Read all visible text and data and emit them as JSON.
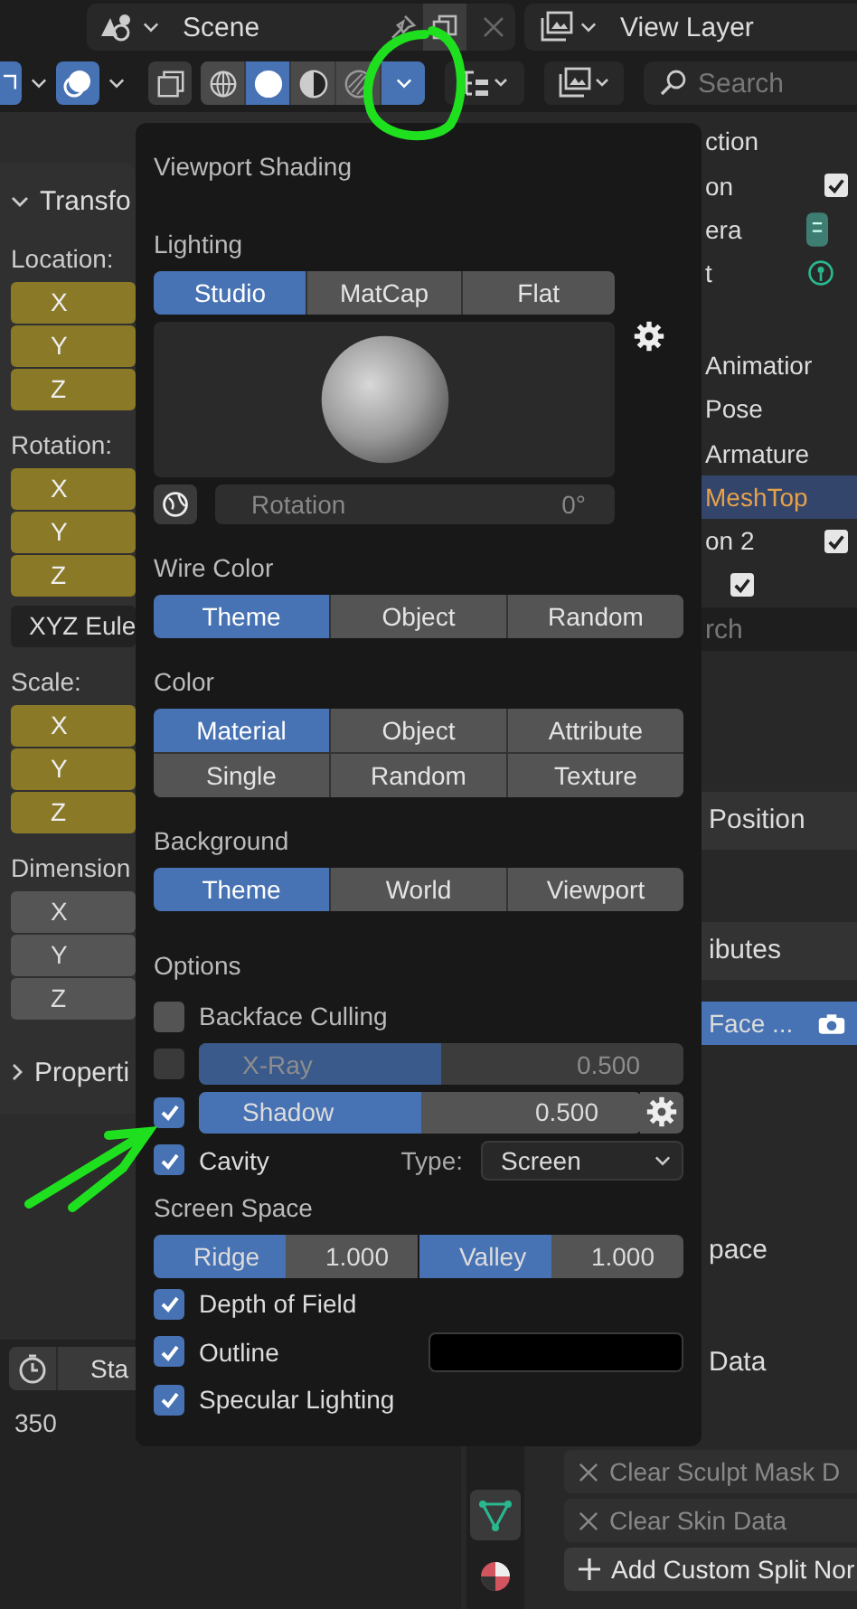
{
  "header": {
    "scene": "Scene",
    "view_layer": "View Layer"
  },
  "toolbar": {
    "shading_modes": [
      {
        "kind": "wireframe",
        "selected": false
      },
      {
        "kind": "solid",
        "selected": true
      },
      {
        "kind": "material",
        "selected": false
      },
      {
        "kind": "rendered",
        "selected": false
      }
    ],
    "shading_menu_expanded": true,
    "search": {
      "placeholder": "Search"
    }
  },
  "transform_panel": {
    "title": "Transfo",
    "groups": [
      {
        "label": "Location:",
        "fields": [
          "X",
          "Y",
          "Z"
        ],
        "keyframed": true
      },
      {
        "label": "Rotation:",
        "fields": [
          "X",
          "Y",
          "Z"
        ],
        "keyframed": true,
        "mode": "XYZ Eule"
      },
      {
        "label": "Scale:",
        "fields": [
          "X",
          "Y",
          "Z"
        ],
        "keyframed": true
      },
      {
        "label": "Dimension",
        "fields": [
          "X",
          "Y",
          "Z"
        ],
        "keyframed": false
      }
    ],
    "next_panel": "Properti"
  },
  "timeline": {
    "start_label": "Sta",
    "frame": "350"
  },
  "outliner": {
    "rows": [
      {
        "label": "ction",
        "kind": "plain",
        "selected": false
      },
      {
        "label": "on",
        "kind": "checkbox",
        "checked": true,
        "selected": false
      },
      {
        "label": "era",
        "kind": "camera",
        "selected": false
      },
      {
        "label": "t",
        "kind": "light",
        "selected": false
      },
      {
        "label": "Animatior",
        "kind": "plain",
        "selected": false
      },
      {
        "label": "Pose",
        "kind": "plain",
        "selected": false
      },
      {
        "label": "Armature",
        "kind": "plain",
        "selected": false
      },
      {
        "label": "MeshTop",
        "kind": "plain",
        "selected": true
      },
      {
        "label": "on 2",
        "kind": "checkbox",
        "checked": true,
        "selected": false
      },
      {
        "kind": "checkbox",
        "checked": true,
        "selected": false
      }
    ],
    "search": {
      "placeholder": "rch"
    }
  },
  "properties": {
    "panels": [
      {
        "label": "Position"
      },
      {
        "label": "ibutes"
      }
    ],
    "attribute_field": "Face ...",
    "panels_lower": [
      {
        "label": "pace"
      },
      {
        "label": "Data"
      }
    ],
    "tabs": [
      {
        "kind": "mesh",
        "selected": true
      },
      {
        "kind": "material",
        "selected": false
      }
    ],
    "buttons": [
      {
        "label": "Clear Sculpt Mask D",
        "kind": "clear",
        "disabled": true
      },
      {
        "label": "Clear Skin Data",
        "kind": "clear",
        "disabled": true
      },
      {
        "label": "Add Custom Split Nor",
        "kind": "add",
        "disabled": false
      }
    ]
  },
  "shading_popover": {
    "title": "Viewport Shading",
    "lighting": {
      "label": "Lighting",
      "options": [
        {
          "label": "Studio",
          "selected": true
        },
        {
          "label": "MatCap",
          "selected": false
        },
        {
          "label": "Flat",
          "selected": false
        }
      ],
      "rotation": {
        "label": "Rotation",
        "value": "0°"
      }
    },
    "wire_color": {
      "label": "Wire Color",
      "options": [
        {
          "label": "Theme",
          "selected": true
        },
        {
          "label": "Object",
          "selected": false
        },
        {
          "label": "Random",
          "selected": false
        }
      ]
    },
    "color": {
      "label": "Color",
      "options": [
        {
          "label": "Material",
          "selected": true
        },
        {
          "label": "Object",
          "selected": false
        },
        {
          "label": "Attribute",
          "selected": false
        },
        {
          "label": "Single",
          "selected": false
        },
        {
          "label": "Random",
          "selected": false
        },
        {
          "label": "Texture",
          "selected": false
        }
      ]
    },
    "background": {
      "label": "Background",
      "options": [
        {
          "label": "Theme",
          "selected": true
        },
        {
          "label": "World",
          "selected": false
        },
        {
          "label": "Viewport",
          "selected": false
        }
      ]
    },
    "options": {
      "label": "Options",
      "items": [
        {
          "kind": "checkbox",
          "label": "Backface Culling",
          "checked": false
        },
        {
          "kind": "slider",
          "label": "X-Ray",
          "checked": false,
          "disabled": true,
          "level": 0.5,
          "value": "0.500",
          "settings": false
        },
        {
          "kind": "slider",
          "label": "Shadow",
          "checked": true,
          "disabled": false,
          "level": 0.5,
          "value": "0.500",
          "settings": true
        },
        {
          "kind": "dropdown",
          "label": "Cavity",
          "checked": true,
          "type_label": "Type:",
          "value": "Screen"
        }
      ]
    },
    "screen_space": {
      "label": "Screen Space",
      "sliders": [
        {
          "label": "Ridge",
          "value": "1.000",
          "level": 0.5
        },
        {
          "label": "Valley",
          "value": "1.000",
          "level": 0.5
        }
      ]
    },
    "toggles": [
      {
        "label": "Depth of Field",
        "checked": true
      },
      {
        "label": "Outline",
        "checked": true,
        "color": "#000000"
      },
      {
        "label": "Specular Lighting",
        "checked": true
      }
    ]
  }
}
